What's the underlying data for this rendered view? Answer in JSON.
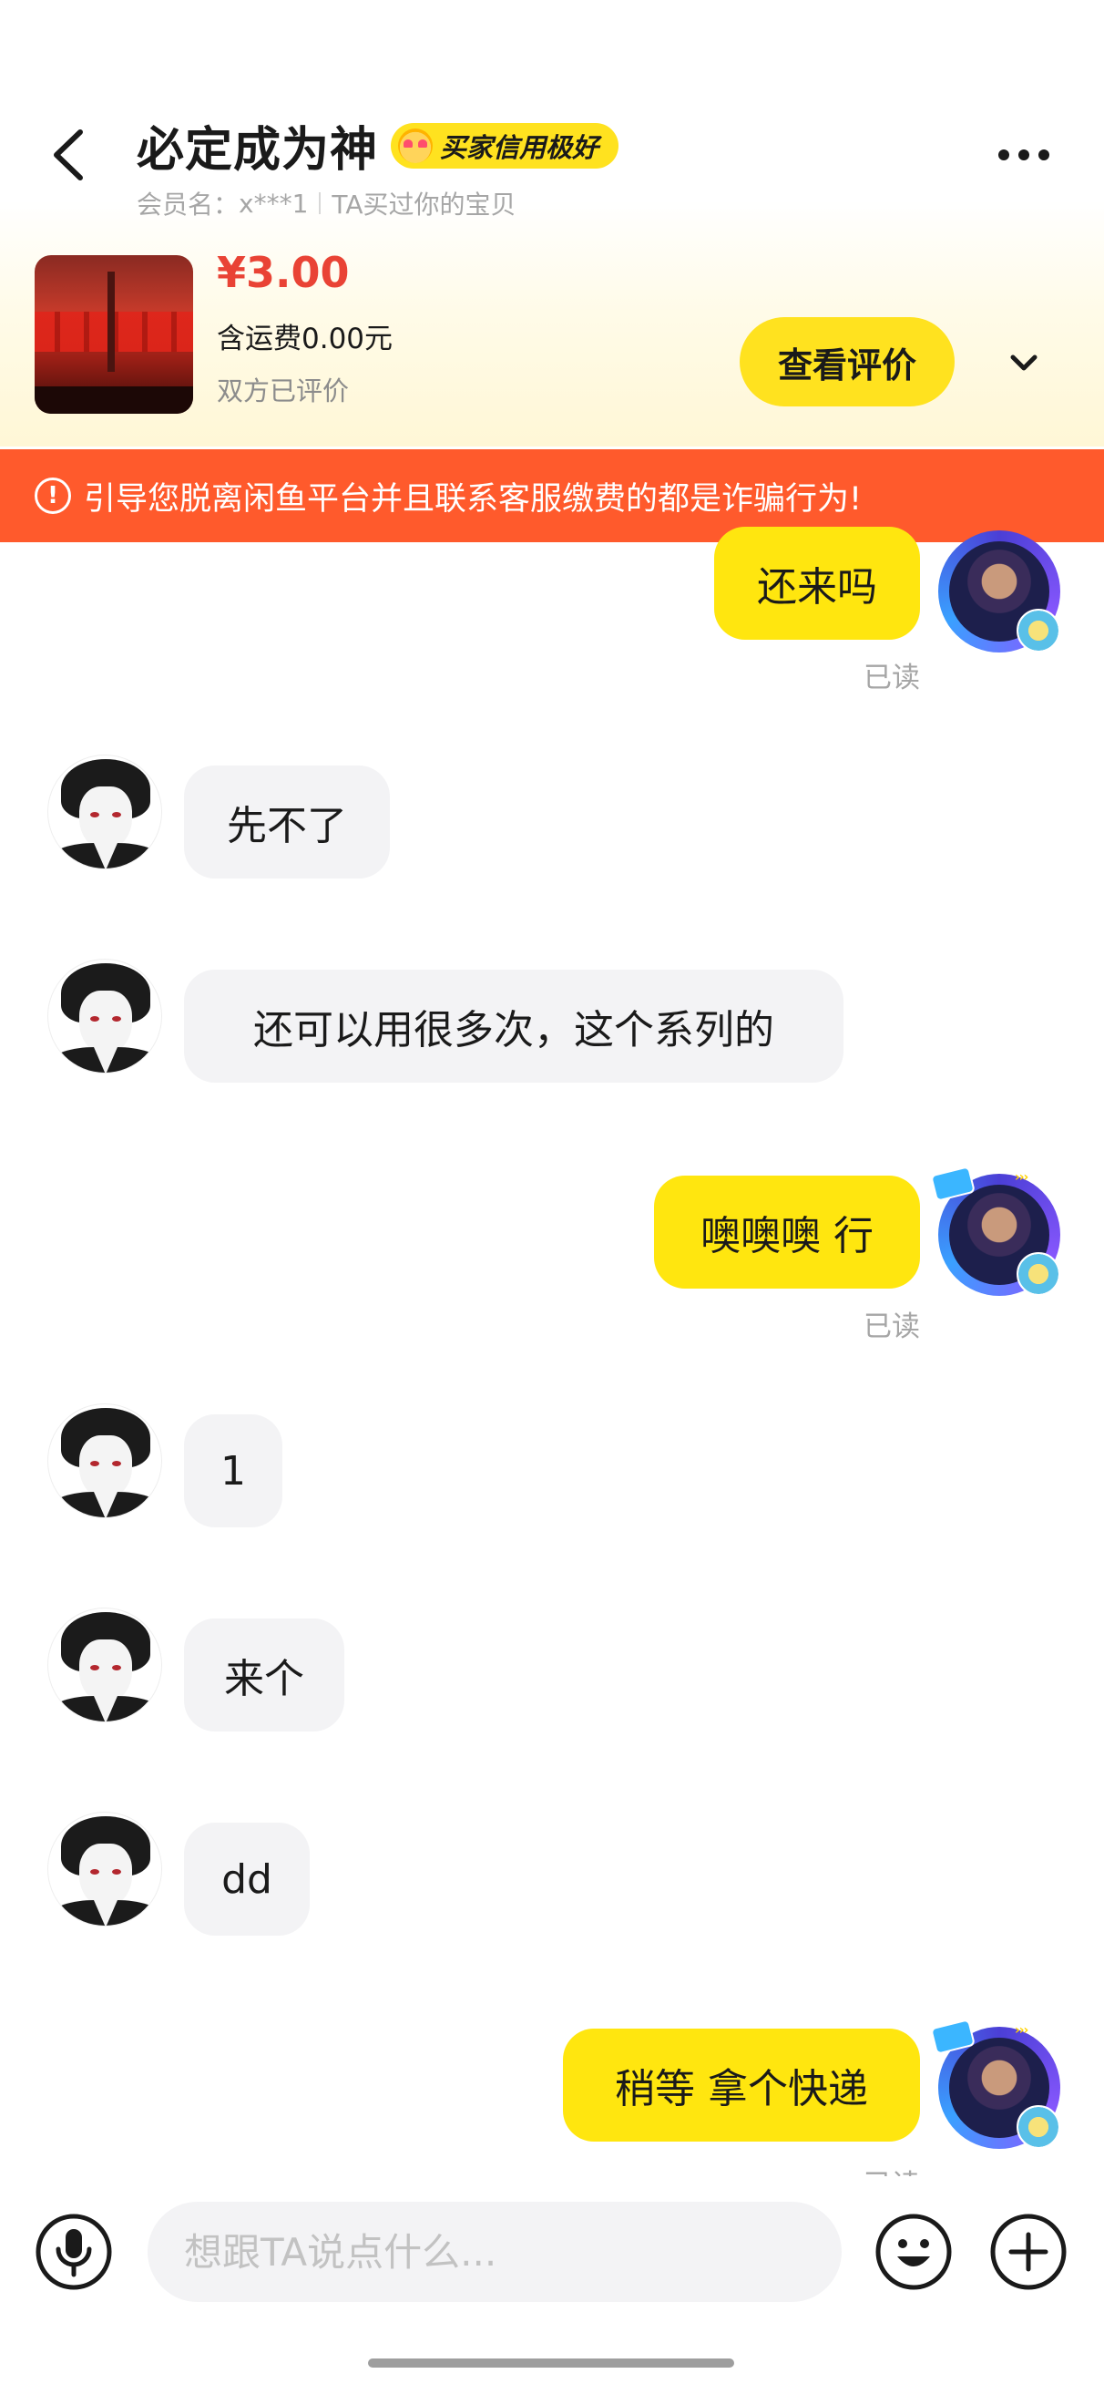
{
  "header": {
    "title": "必定成为神",
    "credit_badge": "买家信用极好",
    "member_label": "会员名：",
    "member_name": "x***1",
    "relation": "TA买过你的宝贝",
    "icons": {
      "back": "back-arrow-icon",
      "more": "more-dots-icon"
    }
  },
  "product": {
    "price": "¥3.00",
    "shipping": "含运费0.00元",
    "review_status": "双方已评价",
    "view_review_button": "查看评价",
    "collapse_icon": "chevron-down-icon"
  },
  "warning": {
    "icon": "exclamation-circle-icon",
    "text": "引导您脱离闲鱼平台并且联系客服缴费的都是诈骗行为!"
  },
  "messages": [
    {
      "from": "me",
      "text": "还来吗",
      "status": "已读"
    },
    {
      "from": "other",
      "text": "先不了"
    },
    {
      "from": "other",
      "text": "还可以用很多次，这个系列的"
    },
    {
      "from": "me",
      "text": "噢噢噢 行",
      "status": "已读"
    },
    {
      "from": "other",
      "text": "1"
    },
    {
      "from": "other",
      "text": "来个"
    },
    {
      "from": "other",
      "text": "dd"
    },
    {
      "from": "me",
      "text": "稍等 拿个快递",
      "status": "已读"
    }
  ],
  "input": {
    "placeholder": "想跟TA说点什么...",
    "icons": {
      "voice": "microphone-icon",
      "emoji": "emoji-face-icon",
      "more": "plus-circle-icon"
    }
  },
  "colors": {
    "brand_yellow": "#ffe60f",
    "warning_orange": "#ff5a2c",
    "price_red": "#e94335",
    "incoming_bubble": "#f3f3f5"
  }
}
